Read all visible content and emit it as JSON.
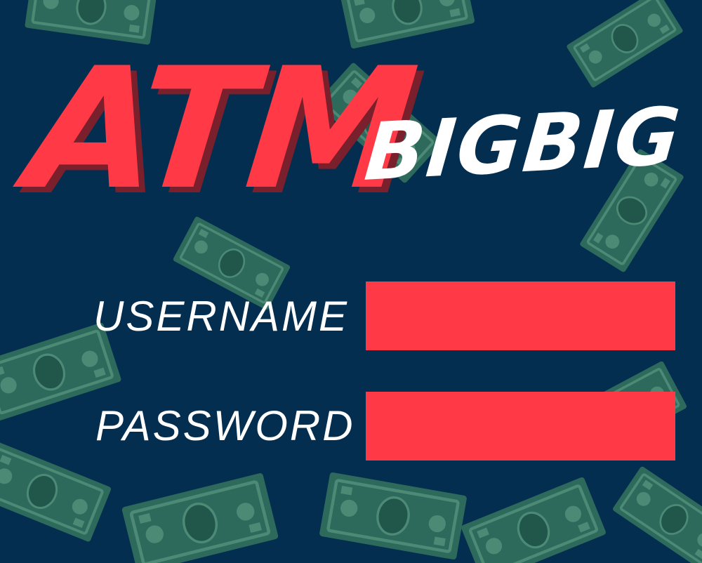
{
  "title": {
    "main": "ATM",
    "sub": "BIGBIG"
  },
  "form": {
    "username": {
      "label": "USERNAME",
      "value": "",
      "placeholder": ""
    },
    "password": {
      "label": "PASSWORD",
      "value": "",
      "placeholder": ""
    }
  },
  "colors": {
    "background": "#042e4f",
    "accent": "#ff3a46",
    "title_shadow": "#7a1f2c",
    "banknote": "#2e6a5c"
  },
  "icons": {
    "decoration": "banknote-icon"
  }
}
